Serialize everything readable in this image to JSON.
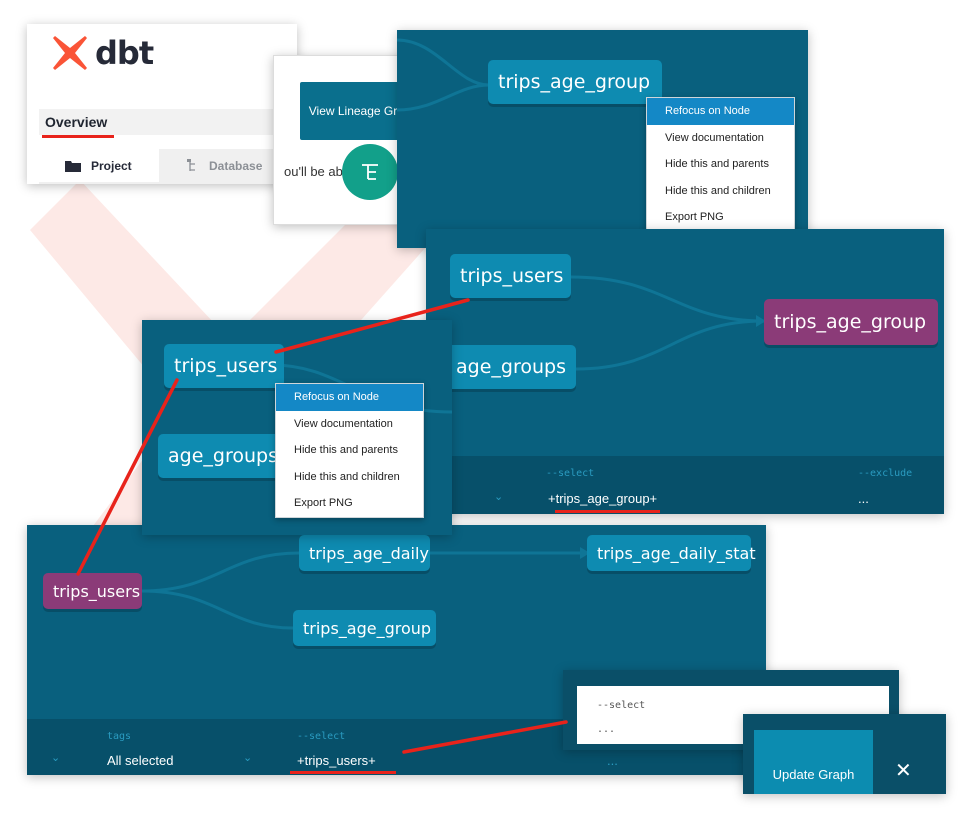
{
  "brand": {
    "logo_text": "dbt",
    "accent": "#fa5437"
  },
  "sidebar": {
    "overview_label": "Overview",
    "tabs": [
      {
        "label": "Project",
        "icon": "folder-icon"
      },
      {
        "label": "Database",
        "icon": "database-tree-icon"
      }
    ]
  },
  "lineage_popup": {
    "tooltip": "View Lineage Graph",
    "hint_text": "ou'll be able",
    "button_icon": "lineage-graph-icon"
  },
  "graph_top": {
    "node": "trips_age_group",
    "context_menu": [
      "Refocus on Node",
      "View documentation",
      "Hide this and parents",
      "Hide this and children",
      "Export PNG"
    ],
    "selected_index": 0
  },
  "graph_mid": {
    "nodes": [
      "trips_users",
      "age_groups",
      "trips_age_group"
    ],
    "select_label": "--select",
    "select_value": "+trips_age_group+",
    "exclude_label": "--exclude",
    "exclude_value": "..."
  },
  "graph_small": {
    "nodes": [
      "trips_users",
      "age_groups"
    ],
    "context_menu": [
      "Refocus on Node",
      "View documentation",
      "Hide this and parents",
      "Hide this and children",
      "Export PNG"
    ],
    "selected_index": 0
  },
  "graph_bottom": {
    "nodes": [
      "trips_users",
      "trips_age_daily",
      "trips_age_daily_stat",
      "trips_age_group"
    ],
    "tags_label": "tags",
    "tags_value": "All selected",
    "select_label": "--select",
    "select_value": "+trips_users+",
    "extra_value": "..."
  },
  "select_input": {
    "label": "--select",
    "value": "..."
  },
  "update": {
    "button_label": "Update Graph",
    "close_icon": "close-icon"
  },
  "colors": {
    "graph_bg": "#09607e",
    "node": "#0e8bb1",
    "focus_node": "#8b3b78",
    "annotation": "#e8231b"
  }
}
